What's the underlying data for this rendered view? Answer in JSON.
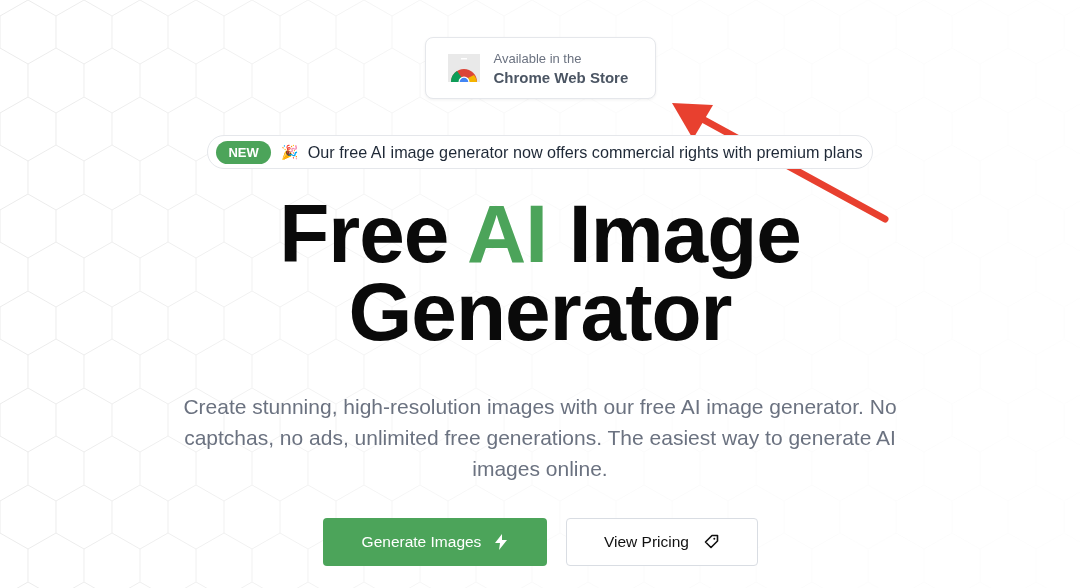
{
  "store_badge": {
    "line_1": "Available in the",
    "line_2": "Chrome Web Store"
  },
  "announcement": {
    "badge": "NEW",
    "emoji": "🎉",
    "text": "Our free AI image generator now offers commercial rights with premium plans"
  },
  "headline": [
    {
      "text": "Free ",
      "accent": false
    },
    {
      "text": "AI",
      "accent": true
    },
    {
      "text": " Image Generator",
      "accent": false
    }
  ],
  "description": "Create stunning, high-resolution images with our free AI image generator. No captchas, no ads, unlimited free generations. The easiest way to generate AI images online.",
  "buttons": [
    {
      "label": "Generate Images",
      "kind": "primary"
    },
    {
      "label": "View Pricing",
      "kind": "secondary"
    }
  ]
}
